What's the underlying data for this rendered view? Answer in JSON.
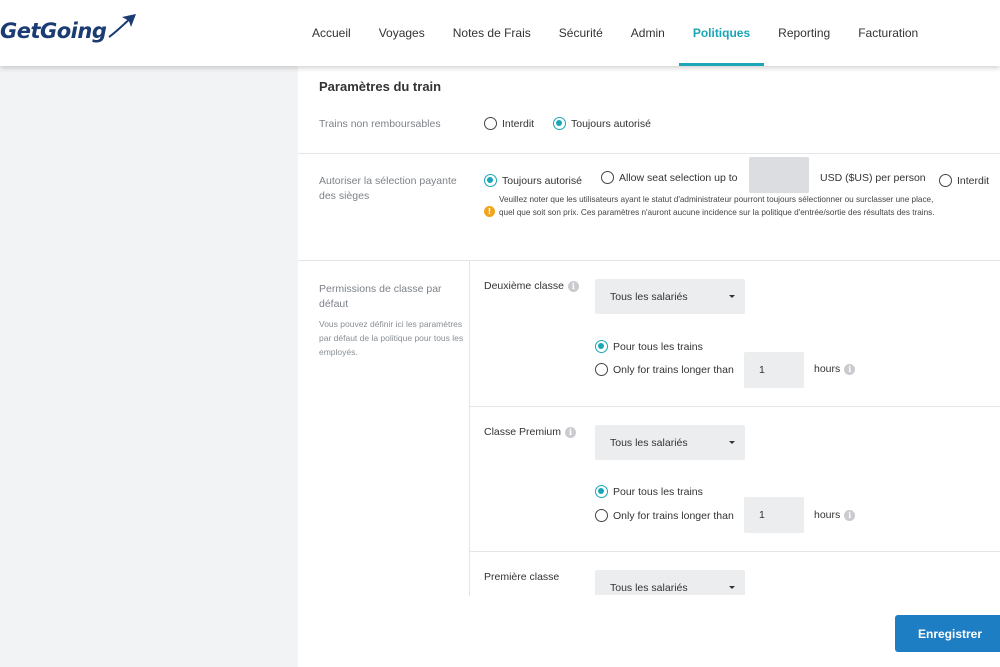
{
  "brand": {
    "logo_text": "GetGoing"
  },
  "nav": {
    "items": [
      {
        "label": "Accueil"
      },
      {
        "label": "Voyages"
      },
      {
        "label": "Notes de Frais"
      },
      {
        "label": "Sécurité"
      },
      {
        "label": "Admin"
      },
      {
        "label": "Politiques",
        "active": true
      },
      {
        "label": "Reporting"
      },
      {
        "label": "Facturation"
      }
    ]
  },
  "colors": {
    "accent": "#1aa6b7",
    "primary_button": "#1e7ec4",
    "warning": "#f0a51c",
    "sidebar_bg": "#f2f3f5"
  },
  "train_settings": {
    "title": "Paramètres du train",
    "non_refundable": {
      "label": "Trains non remboursables",
      "options": [
        {
          "label": "Interdit",
          "selected": false
        },
        {
          "label": "Toujours autorisé",
          "selected": true
        }
      ]
    },
    "seat_selection": {
      "label": "Autoriser la sélection payante des sièges",
      "option_always": "Toujours autorisé",
      "option_upto": "Allow seat selection up to",
      "amount_value": "",
      "currency_suffix": "USD ($US) per person",
      "option_forbidden": "Interdit",
      "selected": "Toujours autorisé",
      "note": "Veuillez noter que les utilisateurs ayant le statut d'administrateur pourront toujours sélectionner ou surclasser une place, quel que soit son prix. Ces paramètres n'auront aucune incidence sur la politique d'entrée/sortie des résultats des trains."
    },
    "class_permissions": {
      "label": "Permissions de classe par défaut",
      "help": "Vous pouvez définir ici les paramètres par défaut de la politique pour tous les employés.",
      "classes": [
        {
          "name": "Deuxième classe",
          "select_value": "Tous les salariés",
          "opt_all": "Pour tous les trains",
          "opt_longer": "Only for trains longer than",
          "hours_value": "1",
          "hours_label": "hours",
          "selected": "all"
        },
        {
          "name": "Classe Premium",
          "select_value": "Tous les salariés",
          "opt_all": "Pour tous les trains",
          "opt_longer": "Only for trains longer than",
          "hours_value": "1",
          "hours_label": "hours",
          "selected": "all"
        },
        {
          "name": "Première classe",
          "select_value": "Tous les salariés"
        }
      ]
    }
  },
  "actions": {
    "save_label": "Enregistrer"
  }
}
